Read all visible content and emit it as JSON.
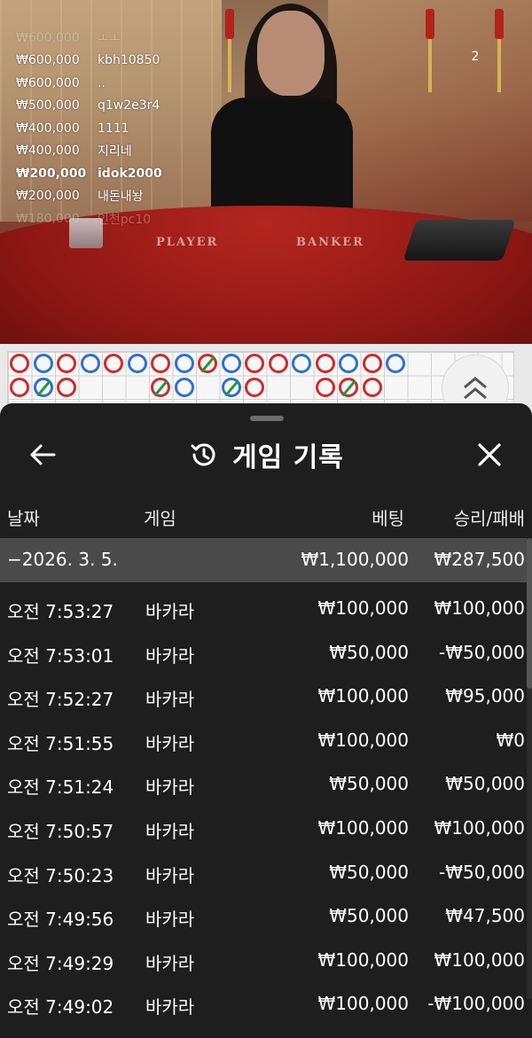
{
  "video": {
    "viewer_count": "2",
    "felt_player": "PLAYER",
    "felt_banker": "BANKER",
    "bets": [
      {
        "amount": "₩600,000",
        "user": "ㅗㅗ"
      },
      {
        "amount": "₩600,000",
        "user": "kbh10850"
      },
      {
        "amount": "₩600,000",
        "user": ".."
      },
      {
        "amount": "₩500,000",
        "user": "q1w2e3r4"
      },
      {
        "amount": "₩400,000",
        "user": "1111"
      },
      {
        "amount": "₩400,000",
        "user": "지리네"
      },
      {
        "amount": "₩200,000",
        "user": "idok2000"
      },
      {
        "amount": "₩200,000",
        "user": "내돈내놩"
      },
      {
        "amount": "₩180,000",
        "user": "인천pc10"
      }
    ]
  },
  "roadmap": {
    "row1": [
      "B",
      "P",
      "B",
      "P",
      "B",
      "P",
      "B",
      "P",
      "B",
      "P",
      "B",
      "B",
      "P",
      "B",
      "P",
      "B",
      "P"
    ],
    "row1_slash": [
      false,
      false,
      false,
      false,
      false,
      false,
      false,
      false,
      true,
      false,
      false,
      false,
      false,
      false,
      false,
      false,
      false
    ],
    "row2": [
      "B",
      "P",
      "B",
      "",
      "",
      "",
      "B",
      "P",
      "",
      "P",
      "B",
      "",
      "",
      "B",
      "B",
      "B",
      ""
    ],
    "row2_slash": [
      false,
      true,
      false,
      false,
      false,
      false,
      true,
      false,
      false,
      true,
      false,
      false,
      false,
      false,
      true,
      false,
      false
    ]
  },
  "history": {
    "title": "게임 기록",
    "columns": {
      "date": "날짜",
      "game": "게임",
      "bet": "베팅",
      "result": "승리/패배"
    },
    "summary": {
      "date": "−2026. 3. 5.",
      "bet": "₩1,100,000",
      "result": "₩287,500"
    },
    "rows": [
      {
        "time": "오전 7:53:27",
        "game": "바카라",
        "bet": "₩100,000",
        "result": "₩100,000"
      },
      {
        "time": "오전 7:53:01",
        "game": "바카라",
        "bet": "₩50,000",
        "result": "-₩50,000"
      },
      {
        "time": "오전 7:52:27",
        "game": "바카라",
        "bet": "₩100,000",
        "result": "₩95,000"
      },
      {
        "time": "오전 7:51:55",
        "game": "바카라",
        "bet": "₩100,000",
        "result": "₩0"
      },
      {
        "time": "오전 7:51:24",
        "game": "바카라",
        "bet": "₩50,000",
        "result": "₩50,000"
      },
      {
        "time": "오전 7:50:57",
        "game": "바카라",
        "bet": "₩100,000",
        "result": "₩100,000"
      },
      {
        "time": "오전 7:50:23",
        "game": "바카라",
        "bet": "₩50,000",
        "result": "-₩50,000"
      },
      {
        "time": "오전 7:49:56",
        "game": "바카라",
        "bet": "₩50,000",
        "result": "₩47,500"
      },
      {
        "time": "오전 7:49:29",
        "game": "바카라",
        "bet": "₩100,000",
        "result": "₩100,000"
      },
      {
        "time": "오전 7:49:02",
        "game": "바카라",
        "bet": "₩100,000",
        "result": "-₩100,000"
      }
    ]
  },
  "icons": {
    "back": "arrow-left-icon",
    "history": "history-clock-icon",
    "close": "close-icon",
    "road_up": "double-chevron-up-icon"
  },
  "colors": {
    "banker": "#d12a2a",
    "player": "#2f6fd6",
    "tie": "#1e9a3b",
    "sheet_bg": "#1e1e1e",
    "summary_bg": "#4a4a4a"
  }
}
